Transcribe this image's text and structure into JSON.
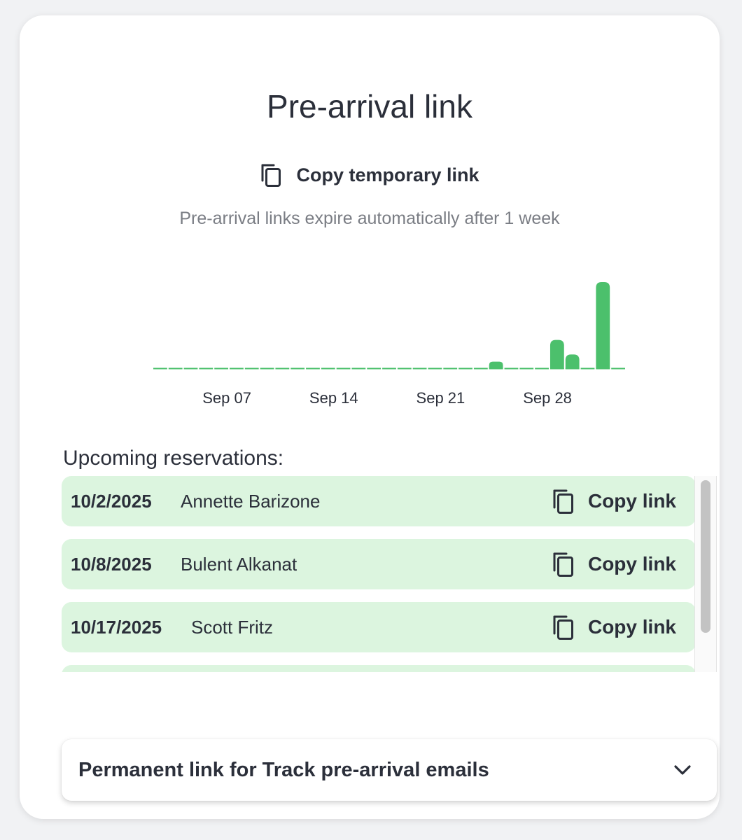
{
  "page": {
    "title": "Pre-arrival link",
    "copy_temporary_label": "Copy temporary link",
    "subtitle": "Pre-arrival links expire automatically after 1 week"
  },
  "chart_data": {
    "type": "bar",
    "title": "",
    "xlabel": "",
    "ylabel": "",
    "x_ticks": [
      "Sep 07",
      "Sep 14",
      "Sep 21",
      "Sep 28"
    ],
    "categories": [
      "Sep 03",
      "Sep 04",
      "Sep 05",
      "Sep 06",
      "Sep 07",
      "Sep 08",
      "Sep 09",
      "Sep 10",
      "Sep 11",
      "Sep 12",
      "Sep 13",
      "Sep 14",
      "Sep 15",
      "Sep 16",
      "Sep 17",
      "Sep 18",
      "Sep 19",
      "Sep 20",
      "Sep 21",
      "Sep 22",
      "Sep 23",
      "Sep 24",
      "Sep 25",
      "Sep 26",
      "Sep 27",
      "Sep 28",
      "Sep 29",
      "Sep 30",
      "Oct 01",
      "Oct 02",
      "Oct 03"
    ],
    "values": [
      0,
      0,
      0,
      0,
      0,
      0,
      0,
      0,
      0,
      0,
      0,
      0,
      0,
      0,
      0,
      0,
      0,
      0,
      0,
      0,
      0,
      0,
      1,
      0,
      0,
      0,
      4,
      2,
      0,
      12,
      0
    ],
    "ylim": [
      0,
      12
    ],
    "color": "#4cc06c",
    "grid": false,
    "legend": "none"
  },
  "upcoming": {
    "label": "Upcoming reservations:",
    "copy_label": "Copy link",
    "rows": [
      {
        "date": "10/2/2025",
        "name": "Annette Barizone"
      },
      {
        "date": "10/8/2025",
        "name": "Bulent Alkanat"
      },
      {
        "date": "10/17/2025",
        "name": "Scott Fritz"
      }
    ]
  },
  "permanent": {
    "label": "Permanent link for Track pre-arrival emails",
    "chevron_icon": "chevron-down-icon"
  },
  "icons": {
    "copy": "copy-icon"
  },
  "colors": {
    "accent_green": "#4cc06c",
    "row_bg": "#dcf5df",
    "text": "#2b2f3a",
    "muted": "#7a7d84"
  }
}
